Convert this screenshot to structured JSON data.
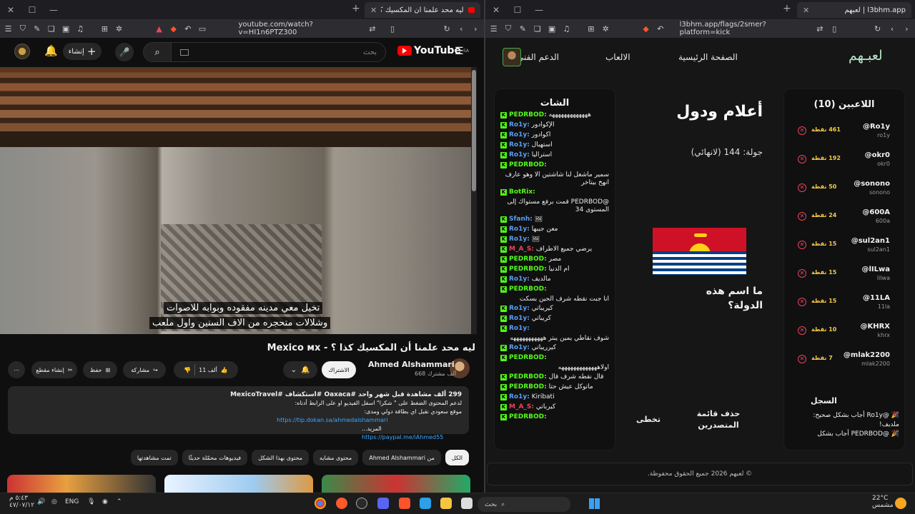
{
  "left_browser": {
    "tab_title": "ليه محد علمنا أن المكسيك كذا ؟",
    "url": "youtube.com/watch?v=HI1n6PTZ300"
  },
  "right_browser": {
    "tab_title": "l3bhm.app | لعبهم",
    "url": "l3bhm.app/flags/2smer?platform=kick"
  },
  "youtube": {
    "search_placeholder": "بحث",
    "create_label": "إنشاء",
    "logo": "YouTube",
    "logo_region": "SA",
    "caption_line1": "تخيل معي مدينه مفقوده وبوابه للاصوات",
    "caption_line2": "وشلالات متحجره من الاف السنين واول ملعب",
    "title": "ليه محد علمنا أن المكسيك كذا ؟ - Mexico ᴍx",
    "channel_name": "Ahmed Alshammari",
    "channel_subs": "668 ألف مشترك",
    "subscribe_label": "الاشتراك",
    "likes": "11 ألف",
    "share_label": "مشاركة",
    "save_label": "حفظ",
    "clip_label": "إنشاء مقطع",
    "desc_stats": "299 ألف مشاهدة  قبل شهر واحد  #Oaxaca  #استكشاف  #MexicoTravel",
    "desc_line2": "لدعم المحتوى الضغط على \" شكرا\" اسفل الفيديو او على الرابط أدناه:",
    "desc_line3": "موقع سعودي نقبل اي بطاقة دولي ومدى:",
    "desc_link1": "https://tip.dokan.sa/ahmedalshammari",
    "desc_link2": "https://paypal.me/iAhmed55",
    "desc_more": "...المزيد",
    "chips": [
      "الكل",
      "من Ahmed Alshammari",
      "محتوى مشابه",
      "محتوى بهذا الشكل",
      "فيديوهات محمّلة حديثًا",
      "تمت مشاهدتها"
    ]
  },
  "site": {
    "logo": "لعبـهم",
    "nav": [
      "الصفحة الرئيسية",
      "الالعاب",
      "الدعم الفني"
    ],
    "game_title": "أعلام ودول",
    "round": "جولة: 144 (لانهائي)",
    "question": "ما اسم هذه الدولة؟",
    "btn_leaderboard": "حذف قائمة المتصدرين",
    "btn_skip": "تخطى",
    "chat_title": "الشات",
    "players_title": "اللاعبين (10)",
    "log_title": "السجل",
    "log_lines": [
      "🎉 @Ro1y أجاب بشكل صحيح: ملديف!",
      "🎉 @PEDRBOD أجاب بشكل"
    ],
    "footer": "© لعبهم 2026 جميع الحقوق محفوظة."
  },
  "chat": [
    {
      "user": "PEDRBOD:",
      "color": "green",
      "msg": "هههههههههههههه"
    },
    {
      "user": "Ro1y:",
      "color": "blue",
      "msg": "الإكوادور"
    },
    {
      "user": "Ro1y:",
      "color": "blue",
      "msg": "اكوادور"
    },
    {
      "user": "Ro1y:",
      "color": "blue",
      "msg": "استهبال"
    },
    {
      "user": "Ro1y:",
      "color": "blue",
      "msg": "استراليا"
    },
    {
      "user": "PEDRBOD:",
      "color": "green",
      "msg": ""
    },
    {
      "user": "",
      "color": "green",
      "msg": "سمير ماشغل لنا شاشتين الا وهو عارف انهخ بيتاخر"
    },
    {
      "user": "BotRix:",
      "color": "green",
      "msg": ""
    },
    {
      "user": "",
      "color": "green",
      "msg": "@PEDRBOD قمت برفع مستواك إلى المستوى 34"
    },
    {
      "user": "Sfanh:",
      "color": "blue",
      "msg": "🖼"
    },
    {
      "user": "Ro1y:",
      "color": "blue",
      "msg": "معن جيبها"
    },
    {
      "user": "Ro1y:",
      "color": "blue",
      "msg": "🖼"
    },
    {
      "user": "M_A_S:",
      "color": "red",
      "msg": "يرضي جميع الاطراف"
    },
    {
      "user": "PEDRBOD:",
      "color": "green",
      "msg": "مصر"
    },
    {
      "user": "PEDRBOD:",
      "color": "green",
      "msg": "ام الدنيا"
    },
    {
      "user": "Ro1y:",
      "color": "blue",
      "msg": "مالديف"
    },
    {
      "user": "PEDRBOD:",
      "color": "green",
      "msg": ""
    },
    {
      "user": "",
      "color": "green",
      "msg": "انا جبت نقطه شرف الحين بسكت"
    },
    {
      "user": "Ro1y:",
      "color": "blue",
      "msg": "كيريباتي"
    },
    {
      "user": "Ro1y:",
      "color": "blue",
      "msg": "كريباتي"
    },
    {
      "user": "Ro1y:",
      "color": "blue",
      "msg": ""
    },
    {
      "user": "",
      "color": "green",
      "msg": "شوف نقاطي يمين يبتر هههههههههههه"
    },
    {
      "user": "Ro1y:",
      "color": "blue",
      "msg": "كيرريباتي"
    },
    {
      "user": "PEDRBOD:",
      "color": "green",
      "msg": ""
    },
    {
      "user": "",
      "color": "green",
      "msg": "اولاهههههههههههههه"
    },
    {
      "user": "PEDRBOD:",
      "color": "green",
      "msg": "قال نقطه شرف قال"
    },
    {
      "user": "PEDRBOD:",
      "color": "green",
      "msg": "ماتوكل عيش حتا"
    },
    {
      "user": "Ro1y:",
      "color": "blue",
      "msg": "Kiribati"
    },
    {
      "user": "M_A_S:",
      "color": "red",
      "msg": "كيرباتي"
    },
    {
      "user": "PEDRBOD:",
      "color": "green",
      "msg": ""
    }
  ],
  "players": [
    {
      "name": "@Ro1y",
      "sub": "ro1y",
      "pts": "461 نقطة"
    },
    {
      "name": "@okr0",
      "sub": "okr0",
      "pts": "192 نقطة"
    },
    {
      "name": "@sonono",
      "sub": "sonono",
      "pts": "50 نقطة"
    },
    {
      "name": "@600A",
      "sub": "600a",
      "pts": "24 نقطة"
    },
    {
      "name": "@sul2an1",
      "sub": "sul2an1",
      "pts": "15 نقطة"
    },
    {
      "name": "@lILwa",
      "sub": "lilwa",
      "pts": "15 نقطة"
    },
    {
      "name": "@11LA",
      "sub": "11la",
      "pts": "15 نقطة"
    },
    {
      "name": "@KHRX",
      "sub": "khrx",
      "pts": "10 نقطة"
    },
    {
      "name": "@mlak2200",
      "sub": "mlak2200",
      "pts": "7 نقطة"
    }
  ],
  "taskbar": {
    "time": "٥:٤٣ م",
    "date": "٤٧/٠٧/١٢",
    "lang": "ENG",
    "search": "بحث",
    "temp": "22°C",
    "weather": "مشمس"
  },
  "colors": {
    "accent_kick": "#53fc18",
    "yt_red": "#ff0000",
    "points": "#f7c948"
  }
}
